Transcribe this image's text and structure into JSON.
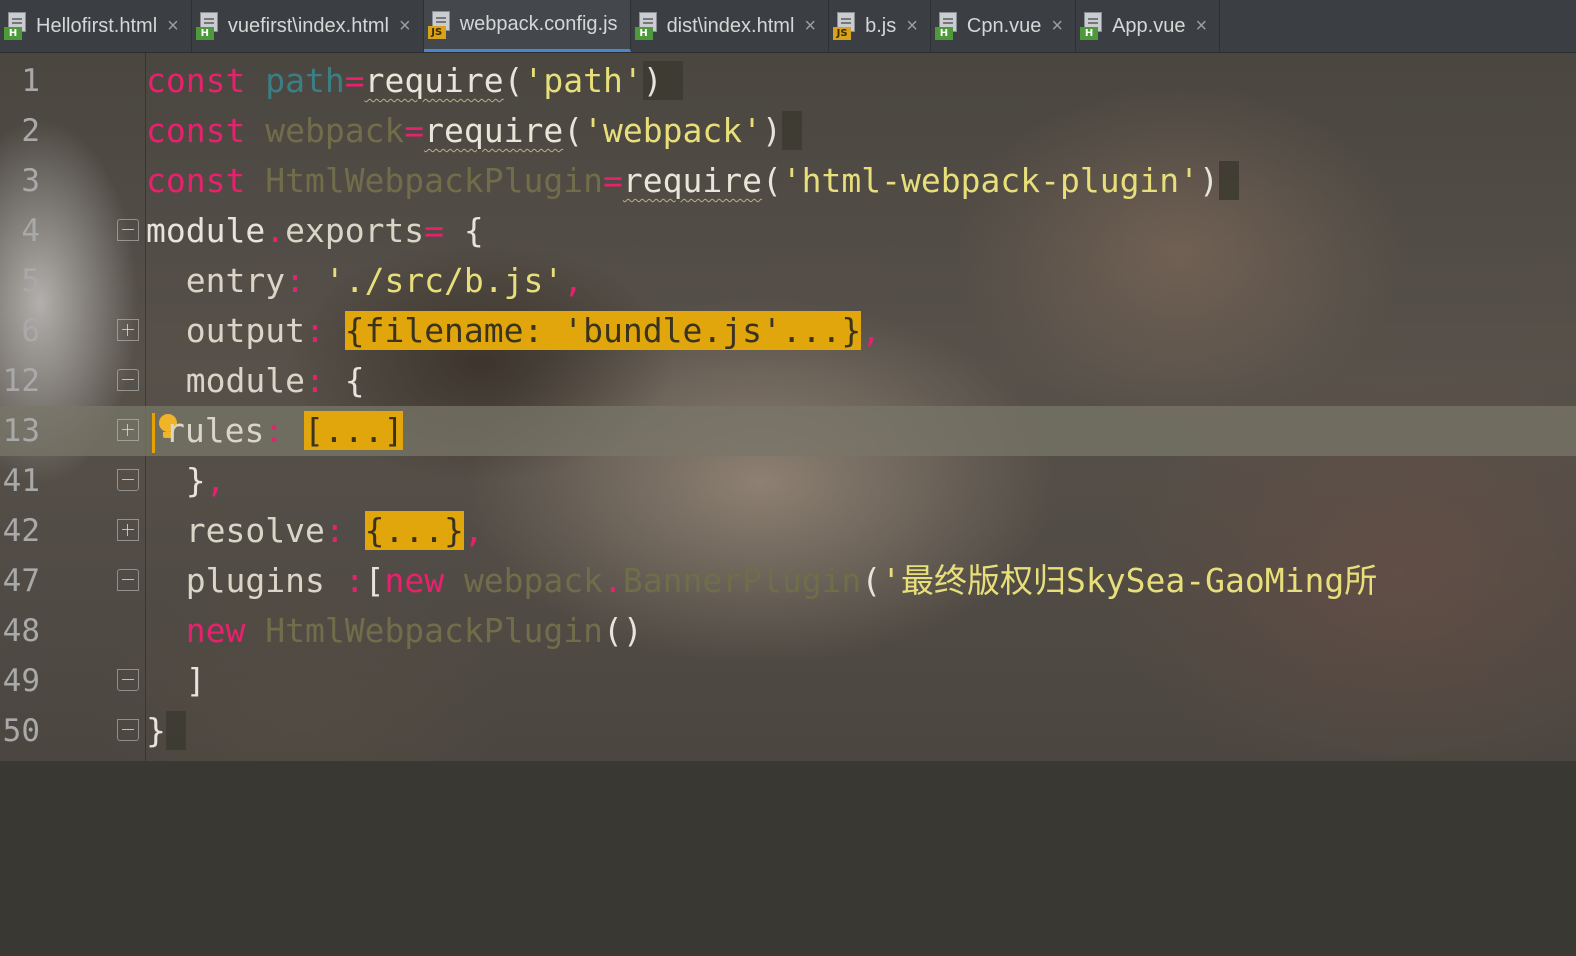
{
  "tabs": [
    {
      "label": "Hellofirst.html",
      "type": "H",
      "active": false
    },
    {
      "label": "vuefirst\\index.html",
      "type": "H",
      "active": false
    },
    {
      "label": "webpack.config.js",
      "type": "JS",
      "active": true
    },
    {
      "label": "dist\\index.html",
      "type": "H",
      "active": false
    },
    {
      "label": "b.js",
      "type": "JS",
      "active": false
    },
    {
      "label": "Cpn.vue",
      "type": "H",
      "active": false
    },
    {
      "label": "App.vue",
      "type": "H",
      "active": false
    }
  ],
  "close_glyph": "×",
  "line_numbers": [
    "1",
    "2",
    "3",
    "4",
    "5",
    "6",
    "12",
    "13",
    "41",
    "42",
    "47",
    "48",
    "49",
    "50"
  ],
  "code": {
    "l1": {
      "kw": "const",
      "name": "path",
      "op": "=",
      "fn": "require",
      "open": "(",
      "str": "'path'",
      "close": ")"
    },
    "l2": {
      "kw": "const",
      "name": "webpack",
      "op": "=",
      "fn": "require",
      "open": "(",
      "str": "'webpack'",
      "close": ")"
    },
    "l3": {
      "kw": "const",
      "name": "HtmlWebpackPlugin",
      "op": "=",
      "fn": "require",
      "open": "(",
      "str": "'html-webpack-plugin'",
      "close": ")"
    },
    "l4": {
      "obj": "module",
      "dot": ".",
      "prop": "exports",
      "op": "=",
      "brace": "{"
    },
    "l5": {
      "key": "entry",
      "colon": ":",
      "str": "'./src/b.js'",
      "comma": ","
    },
    "l6": {
      "key": "output",
      "colon": ":",
      "folded": "{filename: 'bundle.js'...}",
      "comma": ","
    },
    "l12": {
      "key": "module",
      "colon": ":",
      "brace": "{"
    },
    "l13": {
      "key": "rules",
      "colon": ":",
      "folded": "[...]"
    },
    "l41": {
      "close": "}",
      "comma": ","
    },
    "l42": {
      "key": "resolve",
      "colon": ":",
      "folded": "{...}",
      "comma": ","
    },
    "l47": {
      "key": "plugins",
      "colon": ":",
      "bracket": "[",
      "kw": "new",
      "ns": "webpack",
      "dot": ".",
      "cls": "BannerPlugin",
      "open": "(",
      "str": "'最终版权归SkySea-GaoMing所"
    },
    "l48": {
      "kw": "new",
      "cls": "HtmlWebpackPlugin",
      "parens": "()"
    },
    "l49": {
      "bracket": "]"
    },
    "l50": {
      "brace": "}"
    }
  },
  "colors": {
    "keyword": "#e8206d",
    "string": "#e8df7a",
    "fold_highlight": "#e2a60d",
    "active_tab_underline": "#4a88c7"
  },
  "icons": {
    "html_file": "html-file-icon",
    "js_file": "js-file-icon",
    "intention": "lightbulb-icon"
  }
}
